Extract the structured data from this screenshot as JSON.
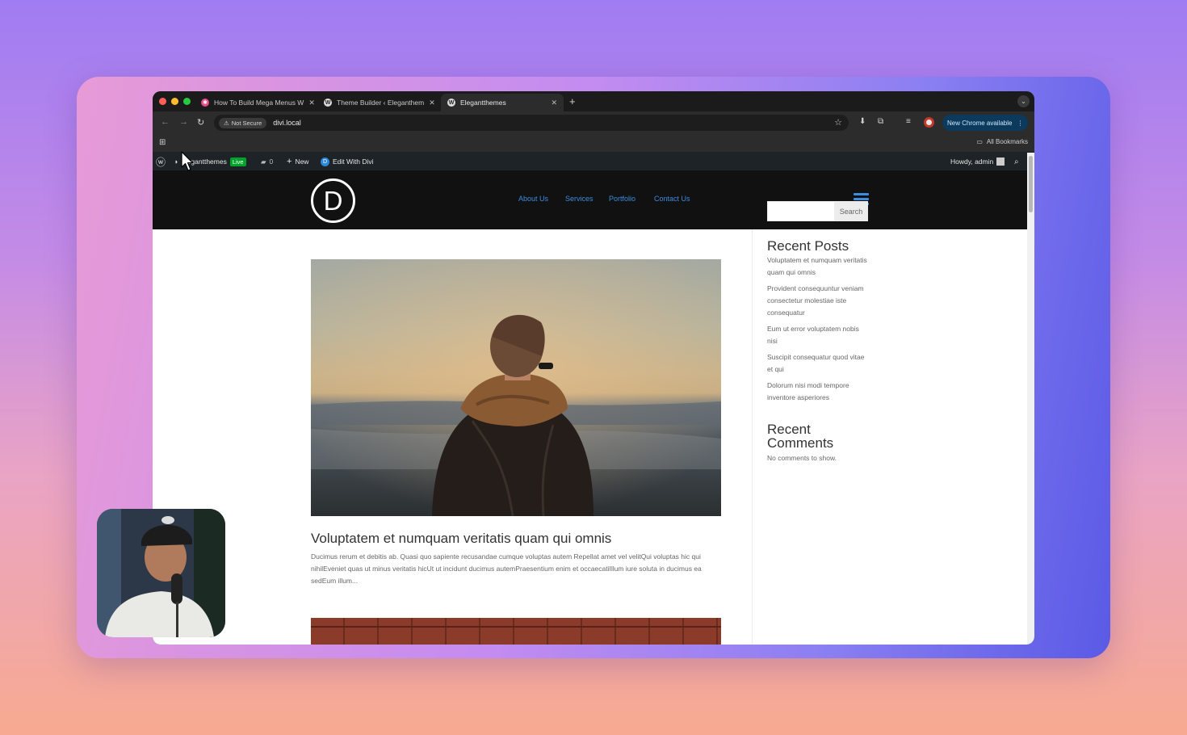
{
  "tabs": [
    {
      "title": "How To Build Mega Menus W",
      "favicon_color": "#e94b8a",
      "active": false
    },
    {
      "title": "Theme Builder ‹ Eleganthem",
      "favicon_color": "#dcdcdc",
      "active": false
    },
    {
      "title": "Elegantthemes",
      "favicon_color": "#dcdcdc",
      "active": true
    }
  ],
  "new_tab_label": "+",
  "toolbar": {
    "security_label": "Not Secure",
    "url": "divi.local",
    "new_chrome_label": "New Chrome available"
  },
  "bookmarks": {
    "all_bookmarks_label": "All Bookmarks"
  },
  "admin_bar": {
    "site_name": "Elegantthemes",
    "live_badge": "Live",
    "comments_count": "0",
    "new_label": "New",
    "edit_label": "Edit With Divi",
    "howdy": "Howdy, admin"
  },
  "site": {
    "logo_letter": "D",
    "menu": [
      "About Us",
      "Services",
      "Portfolio",
      "Contact Us"
    ],
    "accent_color": "#3c8de0"
  },
  "post": {
    "title": "Voluptatem et numquam veritatis quam qui omnis",
    "excerpt": "Ducimus rerum et debitis ab. Quasi quo sapiente recusandae cumque voluptas autem Repellat amet vel velitQui voluptas hic qui nihilEveniet quas ut minus veritatis hicUt ut incidunt ducimus autemPraesentium enim et occaecatiIllum iure soluta in ducimus ea sedEum illum..."
  },
  "sidebar": {
    "search_button": "Search",
    "recent_posts_title": "Recent Posts",
    "recent_posts": [
      "Voluptatem et numquam veritatis quam qui omnis",
      "Provident consequuntur veniam consectetur molestiae iste consequatur",
      "Eum ut error voluptatem nobis nisi",
      "Suscipit consequatur quod vitae et qui",
      "Dolorum nisi modi tempore inventore asperiores"
    ],
    "recent_comments_title": "Recent Comments",
    "no_comments": "No comments to show."
  }
}
